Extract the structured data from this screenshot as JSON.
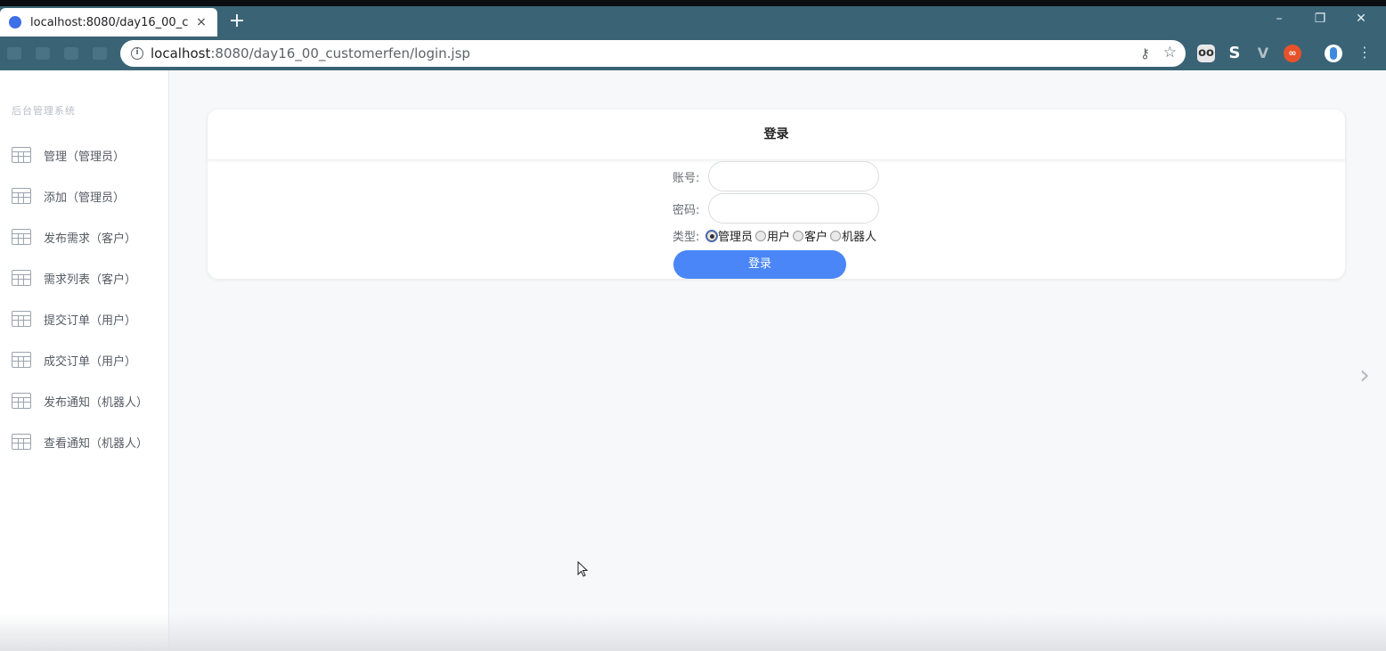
{
  "browser": {
    "tab_title": "localhost:8080/day16_00_customerfen/login.jsp",
    "tab_close": "×",
    "new_tab": "+",
    "url_host": "localhost",
    "url_rest": ":8080/day16_00_customerfen/login.jsp",
    "window_controls": {
      "minimize": "–",
      "maximize": "❐",
      "close": "✕"
    },
    "icons": [
      "info-icon",
      "key-icon",
      "star-icon",
      "extension-icons",
      "profile-avatar",
      "menu-icon"
    ],
    "accent_color": "#3a6476"
  },
  "sidebar": {
    "brand": "后台管理系统",
    "items": [
      {
        "label": "管理（管理员）"
      },
      {
        "label": "添加（管理员）"
      },
      {
        "label": "发布需求（客户）"
      },
      {
        "label": "需求列表（客户）"
      },
      {
        "label": "提交订单（用户）"
      },
      {
        "label": "成交订单（用户）"
      },
      {
        "label": "发布通知（机器人）"
      },
      {
        "label": "查看通知（机器人）"
      }
    ]
  },
  "login": {
    "title": "登录",
    "account_label": "账号:",
    "password_label": "密码:",
    "type_label": "类型:",
    "account_value": "",
    "password_value": "",
    "types": [
      {
        "label": "管理员",
        "checked": true
      },
      {
        "label": "用户",
        "checked": false
      },
      {
        "label": "客户",
        "checked": false
      },
      {
        "label": "机器人",
        "checked": false
      }
    ],
    "submit_label": "登录",
    "button_color": "#4a86f7"
  }
}
